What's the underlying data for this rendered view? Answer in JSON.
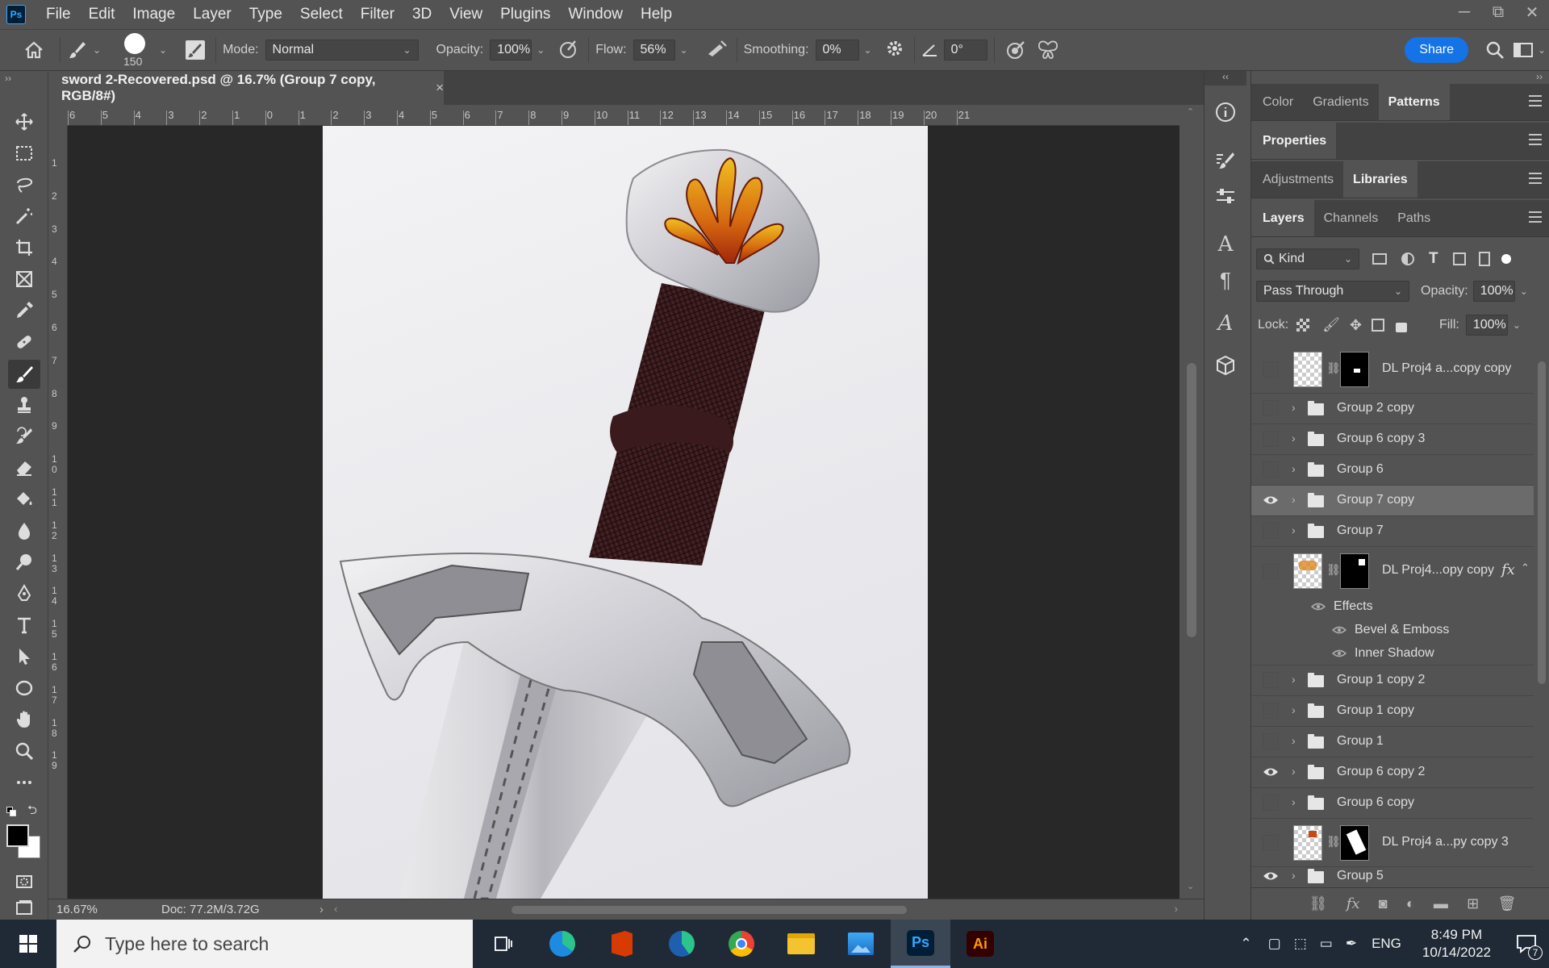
{
  "app": {
    "logo_text": "Ps"
  },
  "menu": [
    "File",
    "Edit",
    "Image",
    "Layer",
    "Type",
    "Select",
    "Filter",
    "3D",
    "View",
    "Plugins",
    "Window",
    "Help"
  ],
  "window_controls": {
    "minimize": "─",
    "restore": "⧉",
    "close": "✕"
  },
  "options": {
    "brush_size": "150",
    "mode_label": "Mode:",
    "mode_value": "Normal",
    "opacity_label": "Opacity:",
    "opacity_value": "100%",
    "flow_label": "Flow:",
    "flow_value": "56%",
    "smoothing_label": "Smoothing:",
    "smoothing_value": "0%",
    "angle_value": "0°",
    "share_label": "Share"
  },
  "document": {
    "tab_title": "sword 2-Recovered.psd @ 16.7% (Group 7 copy, RGB/8#)",
    "close_glyph": "×",
    "zoom": "16.67%",
    "doc_info": "Doc: 77.2M/3.72G"
  },
  "ruler_h_labels": [
    "6",
    "5",
    "4",
    "3",
    "2",
    "1",
    "0",
    "1",
    "2",
    "3",
    "4",
    "5",
    "6",
    "7",
    "8",
    "9",
    "10",
    "11",
    "12",
    "13",
    "14",
    "15",
    "16",
    "17",
    "18",
    "19",
    "20",
    "21"
  ],
  "ruler_v_labels": [
    "1",
    "2",
    "3",
    "4",
    "5",
    "6",
    "7",
    "8",
    "9",
    "1 0",
    "1 1",
    "1 2",
    "1 3",
    "1 4",
    "1 5",
    "1 6",
    "1 7",
    "1 8",
    "1 9"
  ],
  "panels": {
    "top_tabs": [
      "Color",
      "Gradients",
      "Patterns"
    ],
    "mid_tabs": [
      "Properties"
    ],
    "adj_tabs": [
      "Adjustments",
      "Libraries"
    ],
    "layer_tabs": [
      "Layers",
      "Channels",
      "Paths"
    ]
  },
  "layers": {
    "filter_kind": "Kind",
    "blend_mode": "Pass Through",
    "opacity_label": "Opacity:",
    "opacity_value": "100%",
    "lock_label": "Lock:",
    "fill_label": "Fill:",
    "fill_value": "100%",
    "items": [
      {
        "name": "DL Proj4 a...copy copy",
        "type": "smart"
      },
      {
        "name": "Group 2 copy",
        "type": "group"
      },
      {
        "name": "Group 6 copy 3",
        "type": "group"
      },
      {
        "name": "Group 6",
        "type": "group"
      },
      {
        "name": "Group 7 copy",
        "type": "group"
      },
      {
        "name": "Group 7",
        "type": "group"
      },
      {
        "name": "DL Proj4...opy copy",
        "type": "smart-fx"
      },
      {
        "name": "Effects",
        "type": "effect-header"
      },
      {
        "name": "Bevel & Emboss",
        "type": "effect"
      },
      {
        "name": "Inner Shadow",
        "type": "effect"
      },
      {
        "name": "Group 1 copy 2",
        "type": "group"
      },
      {
        "name": "Group 1 copy",
        "type": "group"
      },
      {
        "name": "Group 1",
        "type": "group"
      },
      {
        "name": "Group 6 copy 2",
        "type": "group"
      },
      {
        "name": "Group 6 copy",
        "type": "group"
      },
      {
        "name": "DL Proj4 a...py copy 3",
        "type": "smart"
      },
      {
        "name": "Group 5",
        "type": "group"
      }
    ],
    "fx_badge": "fx"
  },
  "taskbar": {
    "search_placeholder": "Type here to search",
    "language": "ENG",
    "time": "8:49 PM",
    "date": "10/14/2022",
    "notifications": "7",
    "ai_label": "Ai",
    "ps_label": "Ps"
  },
  "colors": {
    "accent": "#1473e6",
    "ps_blue": "#31a8ff",
    "ai_orange": "#ff9a00"
  }
}
